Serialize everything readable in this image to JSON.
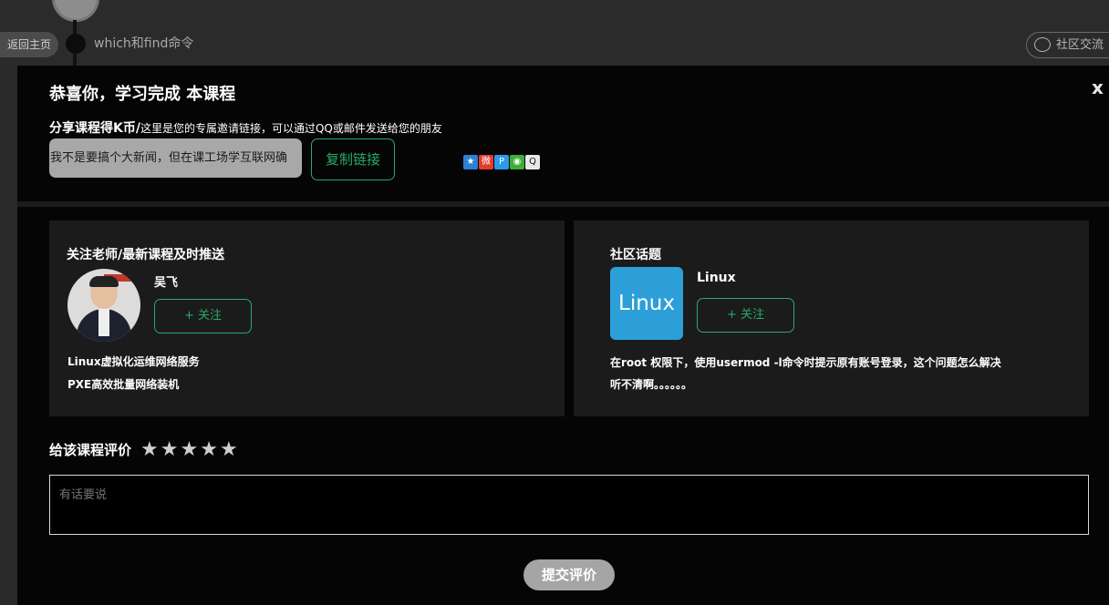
{
  "background": {
    "back_home": "返回主页",
    "chapter_title": "which和find命令",
    "community_button": "社区交流"
  },
  "modal": {
    "title": "恭喜你，学习完成 本课程",
    "close": "x",
    "share": {
      "label_main": "分享课程得K币/",
      "label_sub": "这里是您的专属邀请链接，可以通过QQ或邮件发送给您的朋友",
      "link_text": "我不是要搞个大新闻，但在课工场学互联网确",
      "copy_button": "复制链接",
      "icons": [
        "qzone-icon",
        "weibo-icon",
        "pengyou-icon",
        "wechat-icon",
        "qq-icon"
      ]
    },
    "teacher_card": {
      "title": "关注老师/最新课程及时推送",
      "name": "吴飞",
      "follow_button": "+ 关注",
      "courses": [
        "Linux虚拟化运维网络服务",
        "PXE高效批量网络装机"
      ]
    },
    "topic_card": {
      "title": "社区话题",
      "logo_text": "Linux",
      "topic_name": "Linux",
      "follow_button": "+ 关注",
      "desc_line1": "在root 权限下，使用usermod -l命令时提示原有账号登录，这个问题怎么解决",
      "desc_line2": "听不清啊。。。。。。"
    },
    "rating": {
      "label": "给该课程评价",
      "stars_filled": 0,
      "stars_total": 5
    },
    "comment_placeholder": "有话要说",
    "submit_button": "提交评价"
  },
  "colors": {
    "accent_green": "#2aa86a",
    "modal_bg": "#050505",
    "card_bg": "#1b1b1b"
  }
}
